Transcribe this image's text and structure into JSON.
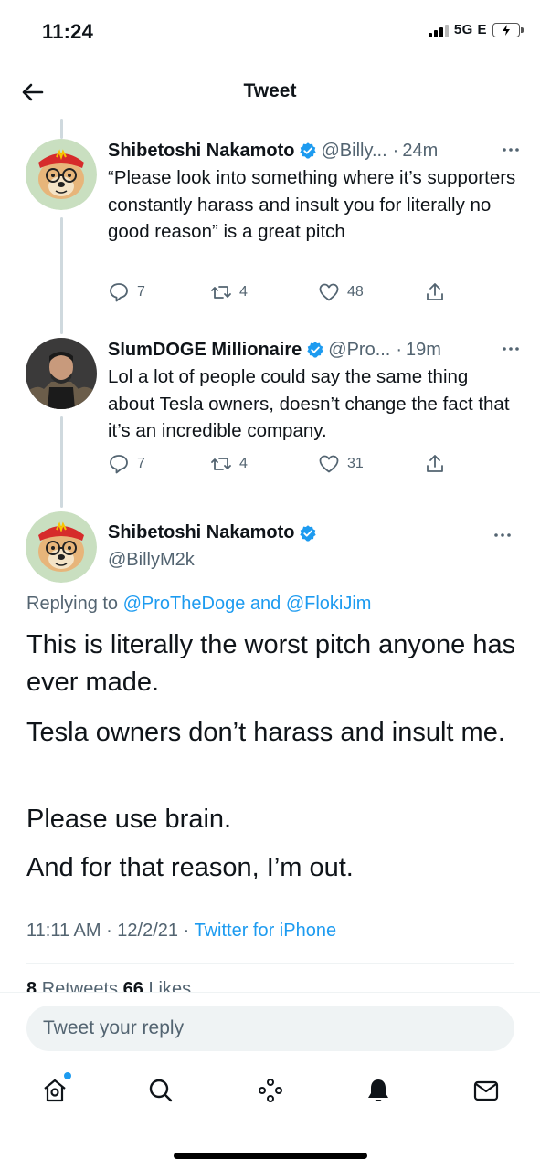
{
  "status_bar": {
    "time": "11:24",
    "network": "5G E"
  },
  "header": {
    "title": "Tweet"
  },
  "thread": [
    {
      "name": "Shibetoshi Nakamoto",
      "handle": "@Billy...",
      "time": "24m",
      "text": "“Please look into something where it’s supporters constantly harass and insult you for literally no good reason” is a great pitch",
      "replies": "7",
      "retweets": "4",
      "likes": "48"
    },
    {
      "name": "SlumDOGE Millionaire",
      "handle": "@Pro...",
      "time": "19m",
      "text": "Lol a lot of people could say the same thing about Tesla owners, doesn’t change the fact that it’s an incredible company.",
      "replies": "7",
      "retweets": "4",
      "likes": "31"
    }
  ],
  "main_tweet": {
    "name": "Shibetoshi Nakamoto",
    "handle": "@BillyM2k",
    "replying_prefix": "Replying to ",
    "replying_user1": "@ProTheDoge",
    "replying_and": " and ",
    "replying_user2": "@FlokiJim",
    "paragraphs": [
      "This is literally the worst pitch anyone has ever made.",
      "Tesla owners don’t harass and insult me.",
      "Please use brain.",
      "And for that reason, I’m out."
    ],
    "timestamp": "11:11 AM · 12/2/21 · ",
    "source": "Twitter for iPhone",
    "retweets_count": "8",
    "retweets_label": "Retweets",
    "likes_count": "66",
    "likes_label": "Likes"
  },
  "reply": {
    "placeholder": "Tweet your reply"
  },
  "tabs": [
    "home-icon",
    "search-icon",
    "spaces-icon",
    "notifications-icon",
    "messages-icon"
  ],
  "colors": {
    "accent": "#1d9bf0",
    "secondary_text": "#536471",
    "text": "#0f1419"
  }
}
